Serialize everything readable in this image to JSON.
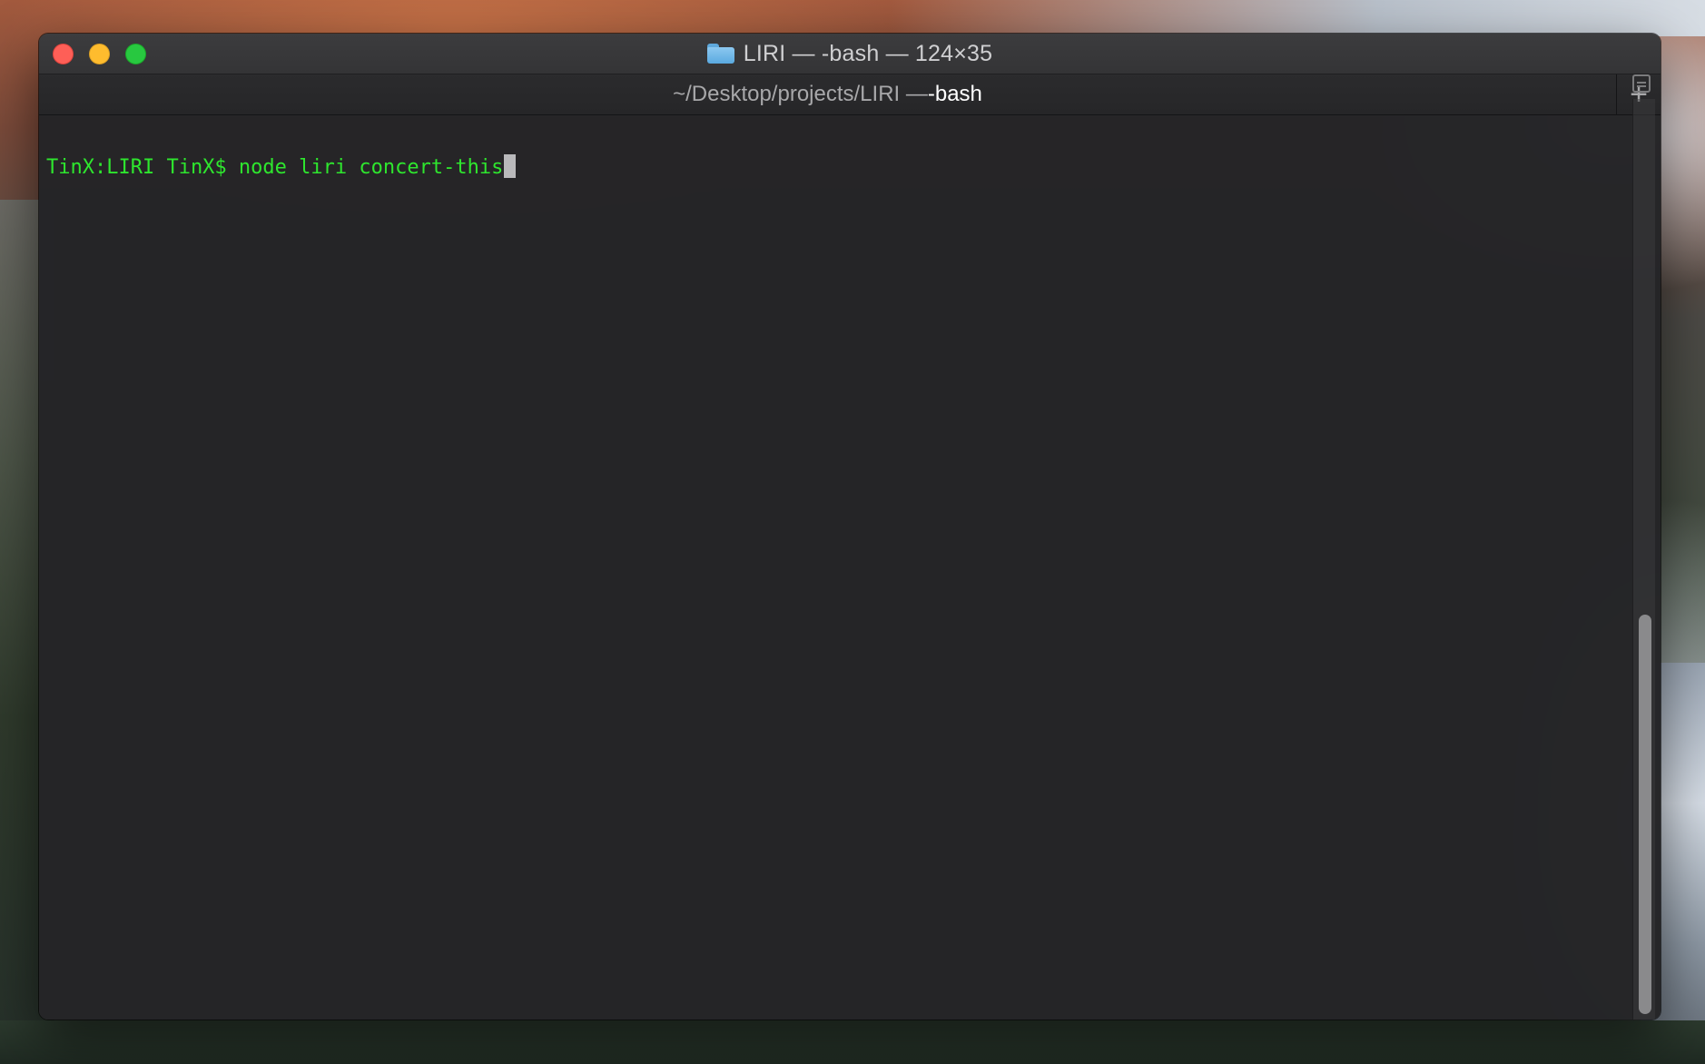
{
  "window": {
    "title": "LIRI — -bash — 124×35",
    "folder_icon": "folder-icon"
  },
  "tab": {
    "path": "~/Desktop/projects/LIRI — ",
    "process": "-bash",
    "new_tab_label": "+"
  },
  "terminal": {
    "prompt": "TinX:LIRI TinX$ ",
    "command": "node liri concert-this"
  },
  "colors": {
    "prompt_text": "#2ee62e",
    "close": "#fe5f57",
    "minimize": "#febc2e",
    "zoom": "#28c840"
  },
  "scroll": {
    "position_fraction": 0.56
  }
}
